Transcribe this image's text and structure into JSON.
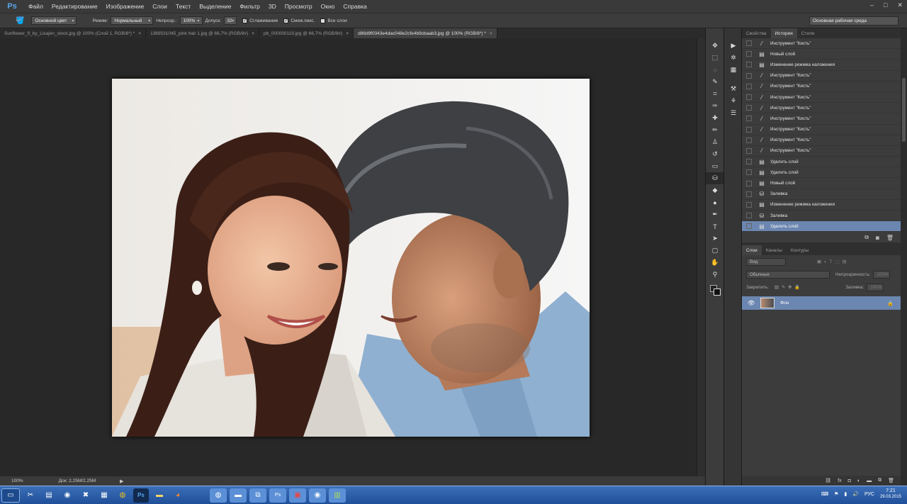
{
  "app": {
    "logo": "Ps"
  },
  "menu": [
    "Файл",
    "Редактирование",
    "Изображение",
    "Слои",
    "Текст",
    "Выделение",
    "Фильтр",
    "3D",
    "Просмотр",
    "Окно",
    "Справка"
  ],
  "window_controls": [
    "–",
    "□",
    "✕"
  ],
  "options": {
    "preset": "Основной цвет",
    "mode_label": "Режим:",
    "mode_value": "Нормальный",
    "opacity_label": "Непрозр.:",
    "opacity_value": "100%",
    "tolerance_label": "Допуск:",
    "tolerance_value": "32",
    "antialias": "Сглаживание",
    "contiguous": "Смеж.пикс.",
    "all_layers": "Все слои",
    "workspace": "Основная рабочая среда"
  },
  "tabs": [
    {
      "label": "Sunflower_9_by_Lisajen_stock.jpg @ 100% (Слой 1, RGB/8*) *",
      "active": false
    },
    {
      "label": "1389531045_pink hair 1.jpg @ 66,7% (RGB/8#)",
      "active": false
    },
    {
      "label": "pb_000000119.jpg @ 66,7% (RGB/8#)",
      "active": false
    },
    {
      "label": "d86d9f0343e4dac048e2cfe4b9cbaab3.jpg @ 100% (RGB/8*) *",
      "active": true
    }
  ],
  "status": {
    "zoom": "100%",
    "doc": "Док: 2,25M/2,25M"
  },
  "history_tabs": [
    "Свойства",
    "История",
    "Стили"
  ],
  "history": [
    {
      "icon": "brush",
      "label": "Инструмент \"Кисть\""
    },
    {
      "icon": "doc",
      "label": "Новый слой"
    },
    {
      "icon": "doc",
      "label": "Изменение режима наложения"
    },
    {
      "icon": "brush",
      "label": "Инструмент \"Кисть\""
    },
    {
      "icon": "brush",
      "label": "Инструмент \"Кисть\""
    },
    {
      "icon": "brush",
      "label": "Инструмент \"Кисть\""
    },
    {
      "icon": "brush",
      "label": "Инструмент \"Кисть\""
    },
    {
      "icon": "brush",
      "label": "Инструмент \"Кисть\""
    },
    {
      "icon": "brush",
      "label": "Инструмент \"Кисть\""
    },
    {
      "icon": "brush",
      "label": "Инструмент \"Кисть\""
    },
    {
      "icon": "brush",
      "label": "Инструмент \"Кисть\""
    },
    {
      "icon": "doc",
      "label": "Удалить слой"
    },
    {
      "icon": "doc",
      "label": "Удалить слой"
    },
    {
      "icon": "doc",
      "label": "Новый слой"
    },
    {
      "icon": "bucket",
      "label": "Заливка"
    },
    {
      "icon": "doc",
      "label": "Изменение режима наложения"
    },
    {
      "icon": "bucket",
      "label": "Заливка"
    },
    {
      "icon": "doc",
      "label": "Удалить слой",
      "selected": true
    }
  ],
  "layers_tabs": [
    "Слои",
    "Каналы",
    "Контуры"
  ],
  "layers": {
    "filter": "Вид",
    "blend": "Обычные",
    "opacity_label": "Непрозрачность:",
    "opacity_value": "100%",
    "lock_label": "Закрепить:",
    "fill_label": "Заливка:",
    "fill_value": "100%",
    "layer_name": "Фон"
  },
  "tray": {
    "lang": "РУС",
    "time": "7:21",
    "date": "29.03.2015"
  },
  "colors": {
    "accent": "#6b86b0",
    "panel": "#3c3c3c",
    "taskbar": "#2a5ca8"
  }
}
